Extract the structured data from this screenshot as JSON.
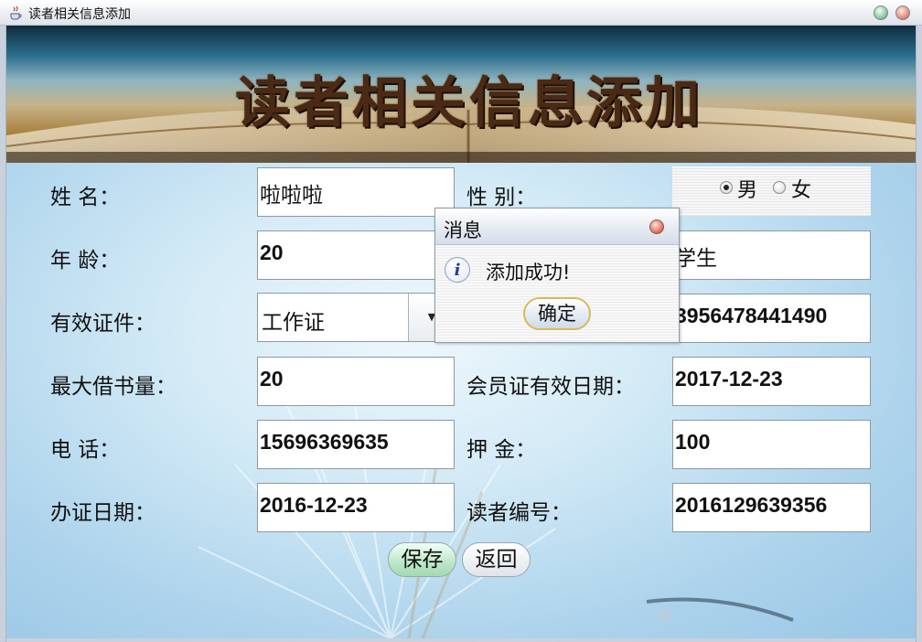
{
  "window": {
    "title": "读者相关信息添加"
  },
  "banner": {
    "title": "读者相关信息添加"
  },
  "form": {
    "name_label": "姓 名：",
    "name_value": "啦啦啦",
    "gender_label": "性 别：",
    "gender_options": [
      "男",
      "女"
    ],
    "gender_selected": "男",
    "age_label": "年 龄：",
    "age_value": "20",
    "occupation_value": "学生",
    "id_type_label": "有效证件：",
    "id_type_value": "工作证",
    "id_number_value": "3956478441490",
    "max_borrow_label": "最大借书量：",
    "max_borrow_value": "20",
    "member_expiry_label": "会员证有效日期：",
    "member_expiry_value": "2017-12-23",
    "phone_label": "电 话：",
    "phone_value": "15696369635",
    "deposit_label": "押 金：",
    "deposit_value": "100",
    "issue_date_label": "办证日期：",
    "issue_date_value": "2016-12-23",
    "reader_id_label": "读者编号：",
    "reader_id_value": "2016129639356"
  },
  "buttons": {
    "save": "保存",
    "back": "返回"
  },
  "dialog": {
    "title": "消息",
    "message": "添加成功!",
    "ok": "确定",
    "icon": "info-icon"
  },
  "colors": {
    "panel_background": "#cfe6f4",
    "save_button": "#bfe8cb",
    "dialog_ok_border": "#d9b95b"
  }
}
